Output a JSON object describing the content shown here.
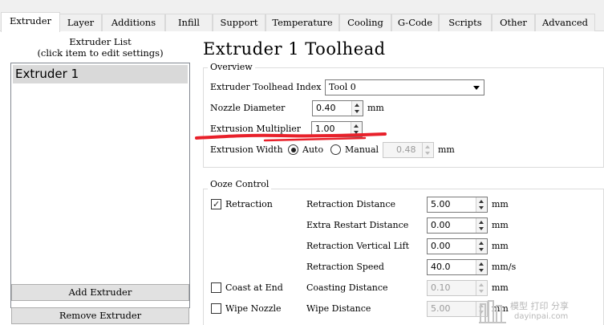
{
  "tabs": [
    "Extruder",
    "Layer",
    "Additions",
    "Infill",
    "Support",
    "Temperature",
    "Cooling",
    "G-Code",
    "Scripts",
    "Other",
    "Advanced"
  ],
  "active_tab": "Extruder",
  "extruder_list": {
    "title_line1": "Extruder List",
    "title_line2": "(click item to edit settings)",
    "items": [
      "Extruder 1"
    ],
    "add_button": "Add Extruder",
    "remove_button": "Remove Extruder"
  },
  "heading": "Extruder 1 Toolhead",
  "overview": {
    "title": "Overview",
    "toolhead_index_label": "Extruder Toolhead Index",
    "toolhead_index_value": "Tool 0",
    "nozzle_diameter_label": "Nozzle Diameter",
    "nozzle_diameter_value": "0.40",
    "nozzle_diameter_unit": "mm",
    "extrusion_multiplier_label": "Extrusion Multiplier",
    "extrusion_multiplier_value": "1.00",
    "extrusion_width_label": "Extrusion Width",
    "auto_label": "Auto",
    "manual_label": "Manual",
    "extrusion_width_value": "0.48",
    "extrusion_width_unit": "mm",
    "width_mode": "Auto"
  },
  "ooze": {
    "title": "Ooze Control",
    "retraction_label": "Retraction",
    "retraction_checked": true,
    "retraction_distance_label": "Retraction Distance",
    "retraction_distance_value": "5.00",
    "retraction_distance_unit": "mm",
    "extra_restart_label": "Extra Restart Distance",
    "extra_restart_value": "0.00",
    "extra_restart_unit": "mm",
    "vertical_lift_label": "Retraction Vertical Lift",
    "vertical_lift_value": "0.00",
    "vertical_lift_unit": "mm",
    "retraction_speed_label": "Retraction Speed",
    "retraction_speed_value": "40.0",
    "retraction_speed_unit": "mm/s",
    "coast_label": "Coast at End",
    "coast_checked": false,
    "coasting_distance_label": "Coasting Distance",
    "coasting_distance_value": "0.10",
    "coasting_distance_unit": "mm",
    "wipe_label": "Wipe Nozzle",
    "wipe_checked": false,
    "wipe_distance_label": "Wipe Distance",
    "wipe_distance_value": "5.00",
    "wipe_distance_unit": "mm"
  },
  "annotation_color": "#e8202a",
  "watermark": {
    "line1": "模型 打印 分享",
    "line2": "dayinpai.com"
  }
}
